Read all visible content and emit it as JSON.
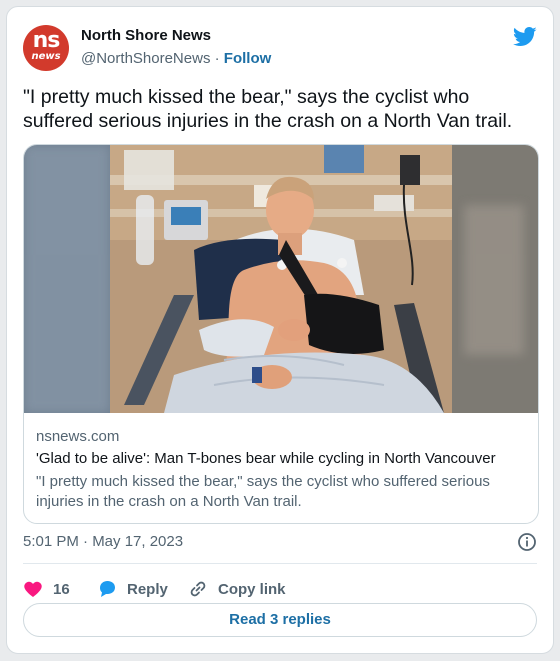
{
  "author": {
    "avatar_text": "ns",
    "avatar_sub": "news",
    "name": "North Shore News",
    "handle": "@NorthShoreNews",
    "separator": "·",
    "follow": "Follow"
  },
  "tweet_text": "\"I pretty much kissed the bear,\" says the cyclist who suffered serious injuries in the crash on a North Van trail.",
  "link_card": {
    "domain": "nsnews.com",
    "title": "'Glad to be alive': Man T-bones bear while cycling in North Vancouver",
    "description": "\"I pretty much kissed the bear,\" says the cyclist who suffered serious injuries in the crash on a North Van trail.",
    "image_icon": "hospital-photo"
  },
  "timestamp": "5:01 PM · May 17, 2023",
  "actions": {
    "likes": "16",
    "reply": "Reply",
    "copy": "Copy link"
  },
  "read_replies": "Read 3 replies",
  "icons": [
    "twitter-bird-icon",
    "heart-icon",
    "reply-bubble-icon",
    "link-icon",
    "info-icon"
  ],
  "colors": {
    "brand_blue": "#1d9bf0",
    "link_blue": "#1d6fa5",
    "heart": "#f91880",
    "avatar_red": "#d23a2c"
  }
}
